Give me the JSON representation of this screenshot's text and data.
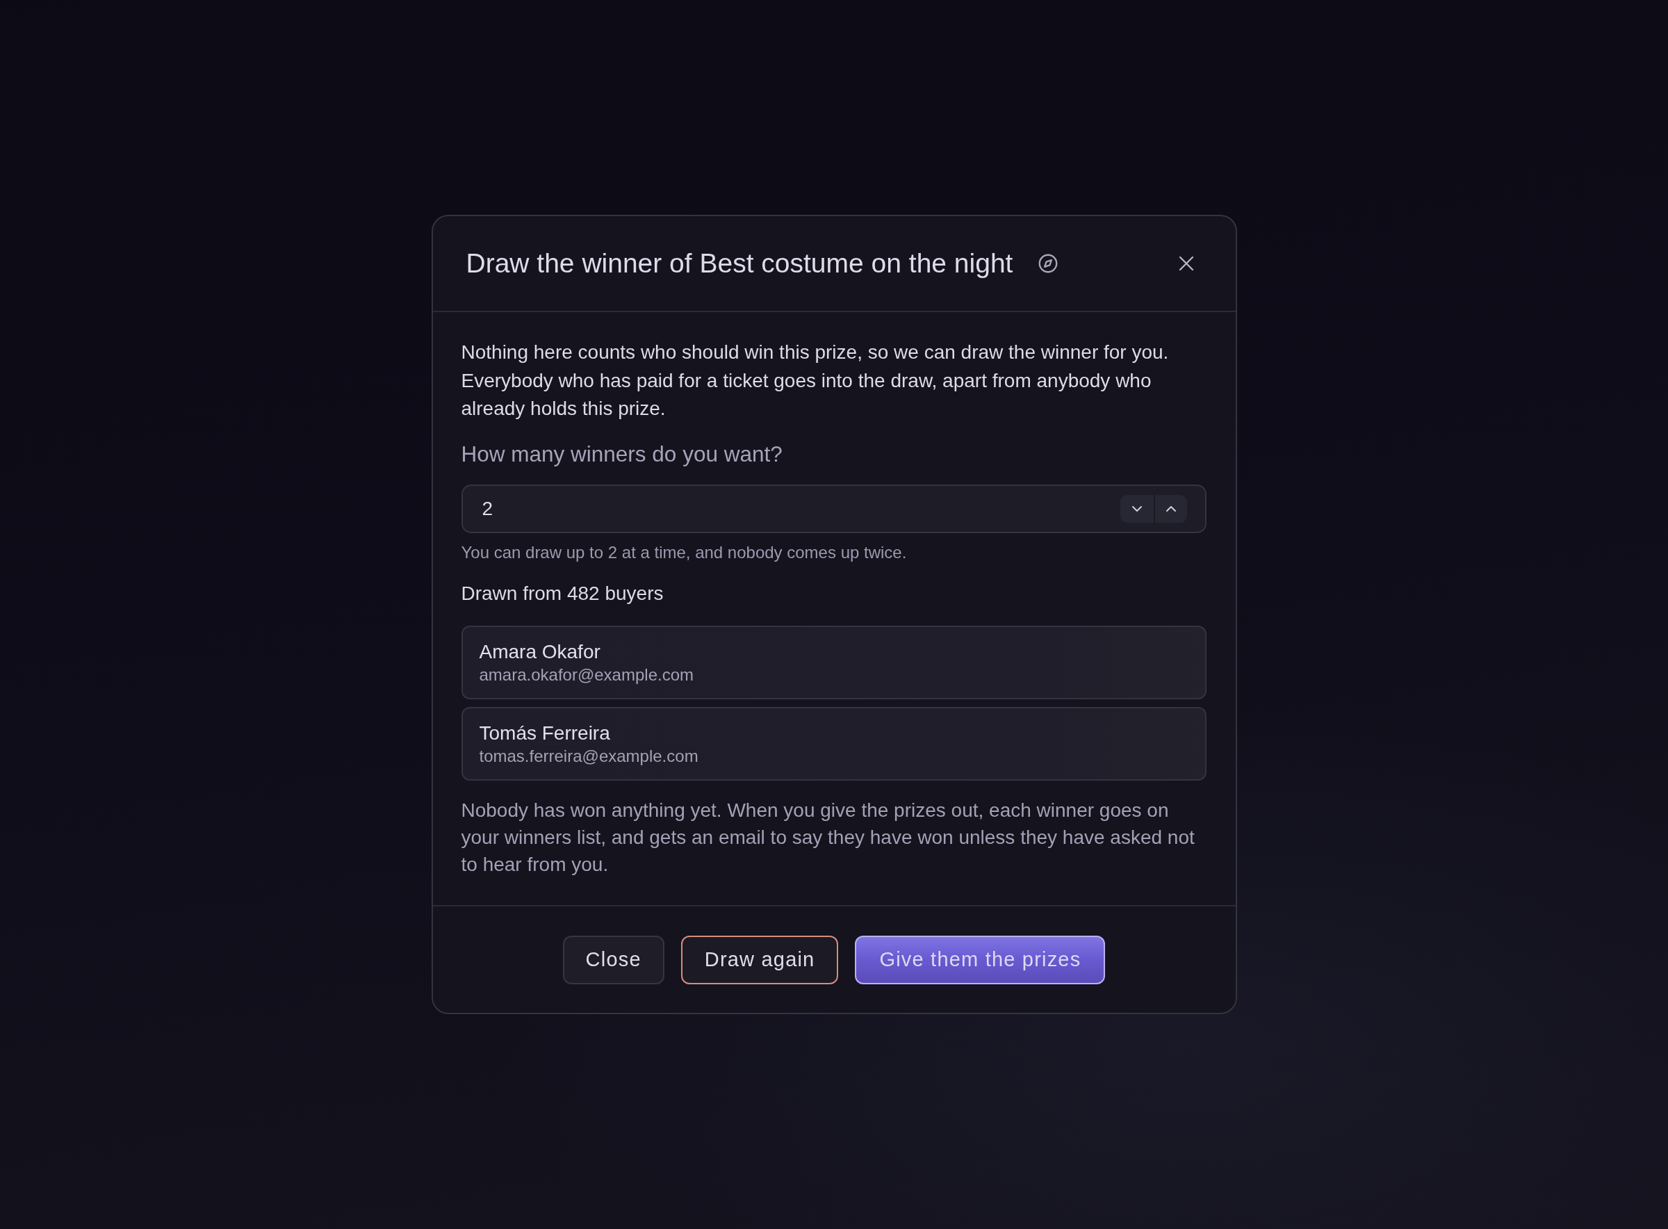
{
  "dialog": {
    "title": "Draw the winner of Best costume on the night",
    "intro": "Nothing here counts who should win this prize, so we can draw the winner for you. Everybody who has paid for a ticket goes into the draw, apart from anybody who already holds this prize.",
    "winner_count": {
      "label": "How many winners do you want?",
      "value": "2",
      "hint": "You can draw up to 2 at a time, and nobody comes up twice."
    },
    "pool_label": "Drawn from 482 buyers",
    "winners": [
      {
        "name": "Amara Okafor",
        "email": "amara.okafor@example.com"
      },
      {
        "name": "Tomás Ferreira",
        "email": "tomas.ferreira@example.com"
      }
    ],
    "note": "Nobody has won anything yet. When you give the prizes out, each winner goes on your winners list, and gets an email to say they have won unless they have asked not to hear from you.",
    "buttons": [
      {
        "label": "Close",
        "kind": "secondary"
      },
      {
        "label": "Draw again",
        "kind": "outline"
      },
      {
        "label": "Give them the prizes",
        "kind": "primary"
      }
    ]
  }
}
